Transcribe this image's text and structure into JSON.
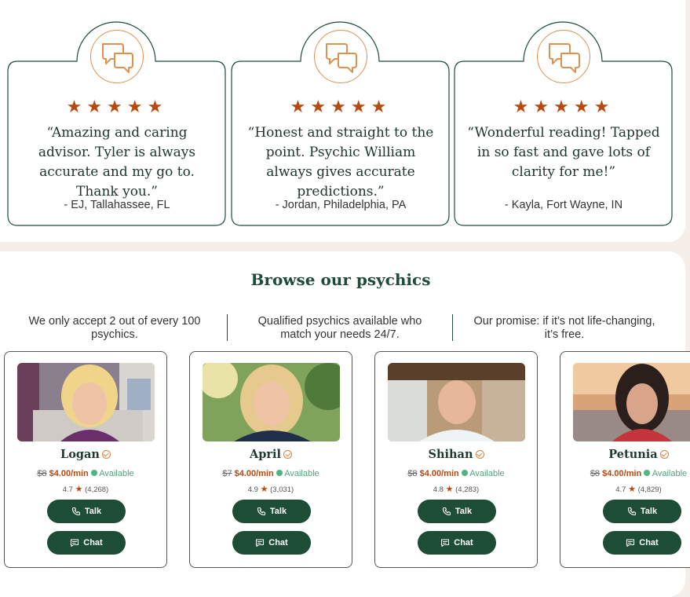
{
  "colors": {
    "brand_green": "#1d4d36",
    "accent_orange": "#b9490e",
    "icon_orange": "#e0904f",
    "available_green": "#4fb583"
  },
  "testimonials": [
    {
      "icon": "chat-bubbles-icon",
      "stars": 5,
      "quote": "“Amazing and caring advisor. Tyler is always accurate and my go to. Thank you.”",
      "author": "- EJ, Tallahassee, FL"
    },
    {
      "icon": "chat-bubbles-icon",
      "stars": 5,
      "quote": "“Honest and straight to the point. Psychic William always gives accurate predictions.”",
      "author": "- Jordan, Philadelphia, PA"
    },
    {
      "icon": "chat-bubbles-icon",
      "stars": 5,
      "quote": "“Wonderful reading! Tapped in so fast and gave lots of clarity for me!”",
      "author": "- Kayla, Fort Wayne, IN"
    }
  ],
  "browse": {
    "title": "Browse our psychics",
    "features": [
      "We only accept 2 out of every 100 psychics.",
      "Qualified psychics available who match your needs 24/7.",
      "Our promise: if it’s not life-changing, it’s free."
    ]
  },
  "psychics": [
    {
      "name": "Logan",
      "old_price": "$8",
      "price": "$4.00/min",
      "status": "Available",
      "rating": "4.7",
      "reviews": "(4,268)",
      "talk": "Talk",
      "chat": "Chat"
    },
    {
      "name": "April",
      "old_price": "$7",
      "price": "$4.00/min",
      "status": "Available",
      "rating": "4.9",
      "reviews": "(3,031)",
      "talk": "Talk",
      "chat": "Chat"
    },
    {
      "name": "Shihan",
      "old_price": "$8",
      "price": "$4.00/min",
      "status": "Available",
      "rating": "4.8",
      "reviews": "(4,283)",
      "talk": "Talk",
      "chat": "Chat"
    },
    {
      "name": "Petunia",
      "old_price": "$8",
      "price": "$4.00/min",
      "status": "Available",
      "rating": "4.7",
      "reviews": "(4,829)",
      "talk": "Talk",
      "chat": "Chat"
    }
  ]
}
